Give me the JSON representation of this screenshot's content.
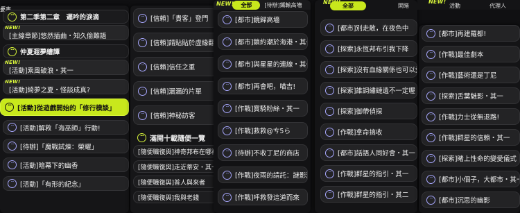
{
  "new_label": "NEW!",
  "top_left_fragment": "要事",
  "col1": {
    "rows": [
      {
        "text": "第二季第二章　遲吟的淚滴",
        "type": "yellow"
      },
      {
        "text": "[主線章節]悠然插曲・知久偷難語",
        "type": "sub"
      },
      {
        "text": "仲夏遐夢繪譚",
        "type": "yellow"
      },
      {
        "text": "[活動]乘風破浪・其一",
        "type": "sub"
      },
      {
        "text": "[活動]綺夢之夏・怪談成真?",
        "type": "sub"
      },
      {
        "text": "[活動]從遊戲開始的「修行模談」",
        "type": "highlight"
      },
      {
        "text": "[活動]解救「海巫師」行動!",
        "type": "blue"
      },
      {
        "text": "[待辦]「魔戰試煉：榮耀」",
        "type": "blue"
      },
      {
        "text": "[活動]暗幕下的幽香",
        "type": "blue"
      },
      {
        "text": "[活動]「有形的紀念」",
        "type": "blue"
      }
    ]
  },
  "col2": {
    "rows": [
      "[信賴]「貴客」登門",
      "[信賴]請貼貼於虛緣翻資",
      "[信賴]信任之重",
      "[信賴]漏漏的片單",
      "[信賴]神秘訪客"
    ],
    "group_title": "滿開十載隨便一覽",
    "group_items": [
      "[隨便職復與]神奇邦布在哪裡",
      "[隨便職復與]走近蒂安・其一",
      "[隨便職復與]普人與來者",
      "[隨便職復與]我與老錢"
    ]
  },
  "col3": {
    "tab_label": "全部",
    "tab_other": "[待辦]鐵輸高墻",
    "rows": [
      "[都市]鏡歸高墻",
      "[都市]鎖約潮於海港・其一",
      "[都市]與星星的連線・其一",
      "[都市]再會吧，喵吉!",
      "[作戰]寶騎粉絲・其一",
      "[作戰]救救@ㄘ5ら",
      "[待辦]不收丁尼的商店",
      "[作戰]夜雨的請託：謎影潮猶",
      "[作戰]呼救發這道而來"
    ]
  },
  "col4": {
    "tabs": [
      "全部",
      "閑睹",
      "活動",
      "代理人"
    ],
    "rows": [
      "[都市]別走散，在夜色中",
      "[探索]永恆邦布引我下降",
      "[探索]沒有血緣關係也可以愛",
      "[探索]誰調繡鏈遺不一定喔",
      "[探索]御帶偵探",
      "[作戰]拿命搞收",
      "[都市]話語人同好會・其一",
      "[作戰]群星的指引・其一",
      "[作戰]群星的指引・其二"
    ]
  },
  "col5": {
    "rows": [
      "[都市]再建羅都!",
      "[作戰]最佳劇本",
      "[作戰]藝術還是丁尼",
      "[探索]舌葉魅影・其一",
      "[作戰]力士從無退路!",
      "[作戰]群星的信賴・其一",
      "[探索]睹上性命的變愛儀式",
      "[都市]小個子，大都市・其一",
      "[都市]沉思的幽影"
    ]
  }
}
